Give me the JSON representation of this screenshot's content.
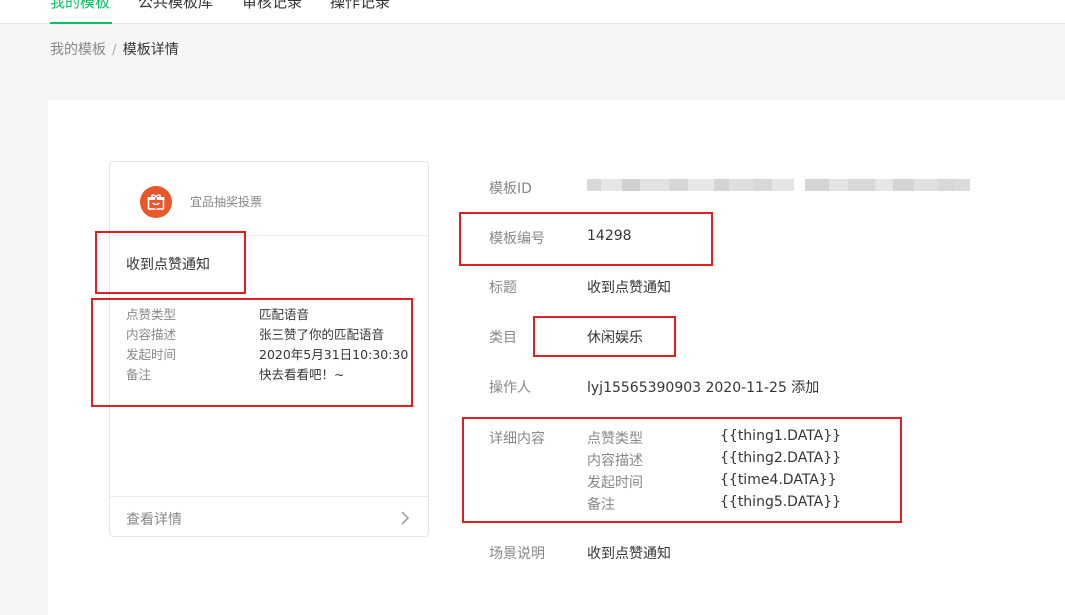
{
  "tabs": [
    {
      "label": "我的模板",
      "active": true
    },
    {
      "label": "公共模板库",
      "active": false
    },
    {
      "label": "审核记录",
      "active": false
    },
    {
      "label": "操作记录",
      "active": false
    }
  ],
  "breadcrumb": {
    "parent": "我的模板",
    "separator": "/",
    "current": "模板详情"
  },
  "preview": {
    "app_name": "宜品抽奖投票",
    "app_icon": "gift-icon",
    "title": "收到点赞通知",
    "fields": [
      {
        "key": "点赞类型",
        "value": "匹配语音"
      },
      {
        "key": "内容描述",
        "value": "张三赞了你的匹配语音"
      },
      {
        "key": "发起时间",
        "value": "2020年5月31日10:30:30"
      },
      {
        "key": "备注",
        "value": "快去看看吧！~"
      }
    ],
    "footer": "查看详情",
    "footer_icon": "chevron-right-icon"
  },
  "info": {
    "template_id": {
      "label": "模板ID"
    },
    "template_no": {
      "label": "模板编号",
      "value": "14298"
    },
    "title": {
      "label": "标题",
      "value": "收到点赞通知"
    },
    "category": {
      "label": "类目",
      "value": "休闲娱乐"
    },
    "operator": {
      "label": "操作人",
      "value": "lyj15565390903 2020-11-25 添加"
    },
    "details": {
      "label": "详细内容",
      "rows": [
        {
          "key": "点赞类型",
          "value": "{{thing1.DATA}}"
        },
        {
          "key": "内容描述",
          "value": "{{thing2.DATA}}"
        },
        {
          "key": "发起时间",
          "value": "{{time4.DATA}}"
        },
        {
          "key": "备注",
          "value": "{{thing5.DATA}}"
        }
      ]
    },
    "scene": {
      "label": "场景说明",
      "value": "收到点赞通知"
    }
  },
  "colors": {
    "accent": "#07c160",
    "highlight": "#e02020",
    "logo": "#e8562c"
  }
}
